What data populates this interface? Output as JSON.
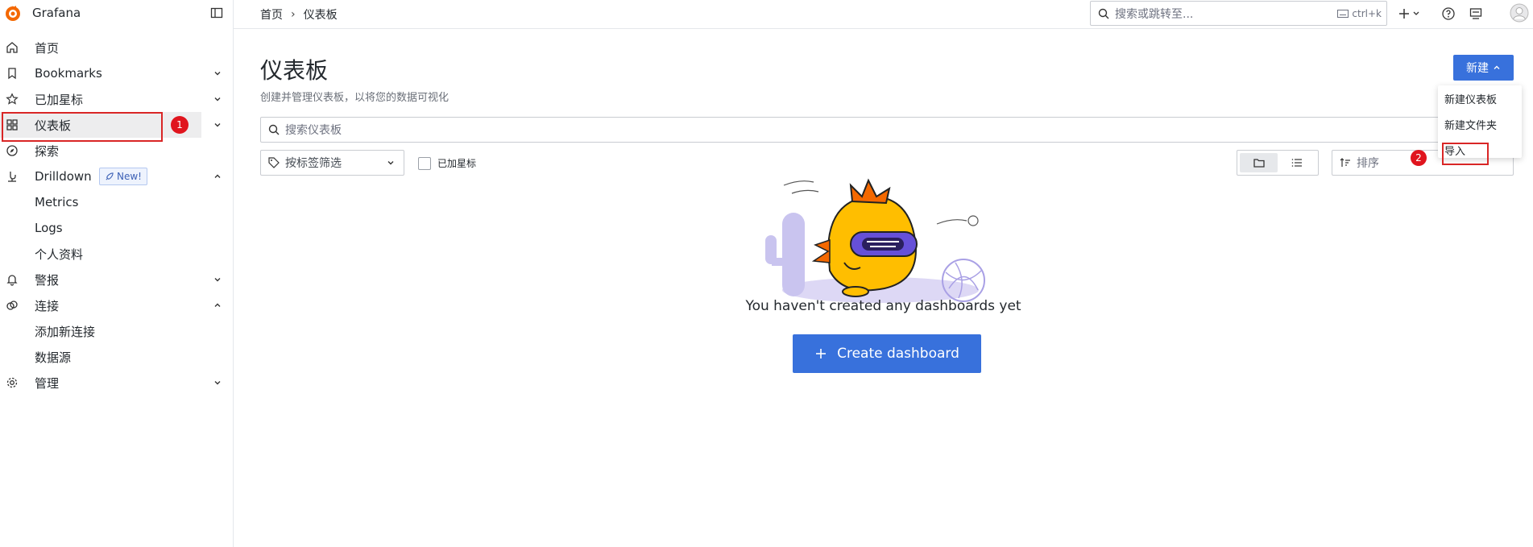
{
  "app": {
    "name": "Grafana"
  },
  "sidebar": {
    "items": [
      {
        "label": "首页",
        "icon": "home-icon"
      },
      {
        "label": "Bookmarks",
        "icon": "bookmark-icon"
      },
      {
        "label": "已加星标",
        "icon": "star-icon"
      },
      {
        "label": "仪表板",
        "icon": "apps-icon"
      },
      {
        "label": "探索",
        "icon": "compass-icon"
      },
      {
        "label": "Drilldown",
        "icon": "drilldown-icon",
        "badge": "New!"
      },
      {
        "label": "警报",
        "icon": "bell-icon"
      },
      {
        "label": "连接",
        "icon": "connections-icon"
      },
      {
        "label": "管理",
        "icon": "gear-icon"
      }
    ],
    "drilldown_children": [
      "Metrics",
      "Logs",
      "个人资料"
    ],
    "connection_children": [
      "添加新连接",
      "数据源"
    ]
  },
  "topbar": {
    "breadcrumb": [
      "首页",
      "仪表板"
    ],
    "search_placeholder": "搜索或跳转至...",
    "search_shortcut": "ctrl+k"
  },
  "main": {
    "title": "仪表板",
    "subtitle": "创建并管理仪表板，以将您的数据可视化",
    "new_button": "新建",
    "search_placeholder": "搜索仪表板",
    "tag_filter_placeholder": "按标签筛选",
    "starred_label": "已加星标",
    "sort_placeholder": "排序",
    "dropdown": [
      "新建仪表板",
      "新建文件夹",
      "导入"
    ],
    "empty_text": "You haven't created any dashboards yet",
    "create_button": "Create dashboard"
  },
  "annotations": [
    {
      "number": "1"
    },
    {
      "number": "2"
    }
  ],
  "colors": {
    "primary": "#3871dc",
    "highlight": "#d92626",
    "badge": "#e0151e"
  }
}
